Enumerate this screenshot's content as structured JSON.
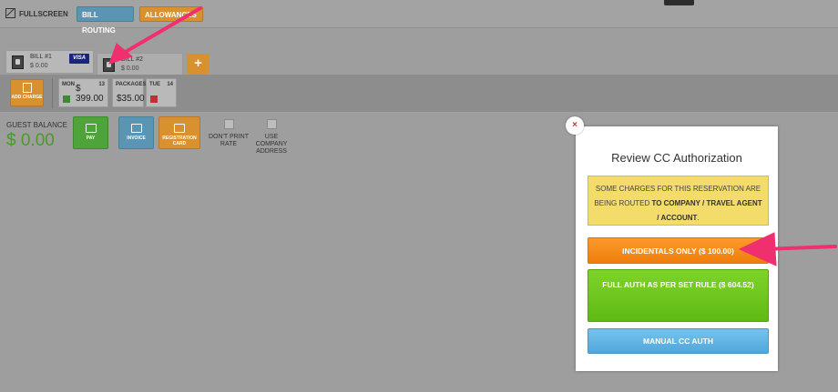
{
  "toolbar": {
    "fullscreen_label": "FULLSCREEN",
    "bill_routing_label": "BILL ROUTING",
    "allowances_label": "ALLOWANCES"
  },
  "bills": [
    {
      "label": "BILL #1",
      "amount": "$ 0.00",
      "card": "VISA"
    },
    {
      "label": "BILL #2",
      "amount": "$ 0.00"
    }
  ],
  "add_bill_label": "+",
  "add_charge_label": "ADD CHARGE",
  "days": [
    {
      "name": "MON",
      "date": "13",
      "value": "$ 399.00"
    },
    {
      "name": "PACKAGES",
      "date": "",
      "value": "$35.00"
    },
    {
      "name": "TUE",
      "date": "14",
      "value": ""
    }
  ],
  "guest_balance": {
    "label": "GUEST BALANCE",
    "value": "$ 0.00"
  },
  "actions": {
    "pay": "PAY",
    "invoice": "INVOICE",
    "registration_card": "REGISTRATION CARD",
    "dont_print_rate": "DON'T PRINT RATE",
    "use_company_address": "USE COMPANY ADDRESS"
  },
  "modal": {
    "close": "×",
    "title": "Review CC Authorization",
    "notice_pre": "SOME CHARGES FOR THIS RESERVATION ARE BEING ROUTED",
    "notice_bold": "TO COMPANY / TRAVEL AGENT / ACCOUNT",
    "notice_post": ".",
    "incidentals_button": "INCIDENTALS ONLY ($ 100.00)",
    "full_auth_button": "FULL AUTH AS PER SET RULE ($ 604.52)",
    "manual_button": "MANUAL CC AUTH"
  },
  "colors": {
    "accent_orange": "#d9902f",
    "accent_blue": "#5a95b4",
    "pay_green": "#4ea33a",
    "annotation_pink": "#f0306e"
  }
}
